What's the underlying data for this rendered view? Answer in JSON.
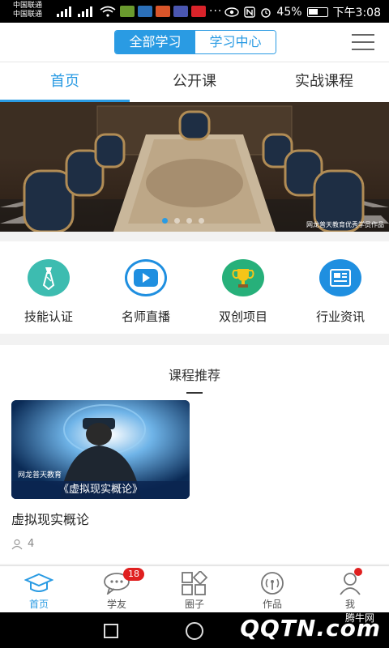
{
  "status": {
    "carrier_1": "中国联通",
    "carrier_2": "中国联通",
    "battery": "45%",
    "time": "下午3:08"
  },
  "header": {
    "seg_all": "全部学习",
    "seg_center": "学习中心"
  },
  "tabs": [
    {
      "label": "首页"
    },
    {
      "label": "公开课"
    },
    {
      "label": "实战课程"
    }
  ],
  "banner": {
    "credit": "网龙普天教育优秀学员作品",
    "slides": 4,
    "active_slide": 1
  },
  "quick": [
    {
      "label": "技能认证",
      "icon": "tie-icon",
      "color": "#3dbcb0"
    },
    {
      "label": "名师直播",
      "icon": "video-icon",
      "color": "#1f8fe0"
    },
    {
      "label": "双创项目",
      "icon": "trophy-icon",
      "color": "#27b07a"
    },
    {
      "label": "行业资讯",
      "icon": "news-icon",
      "color": "#1f8fe0"
    }
  ],
  "courses": {
    "title": "课程推荐",
    "items": [
      {
        "name": "虚拟现实概论",
        "thumb_brand": "网龙普天教育",
        "thumb_caption": "《虚拟现实概论》",
        "learners": "4"
      }
    ]
  },
  "bottom_nav": [
    {
      "label": "首页",
      "icon": "mortarboard-icon"
    },
    {
      "label": "学友",
      "icon": "chat-icon",
      "badge": "18"
    },
    {
      "label": "圈子",
      "icon": "grid-icon"
    },
    {
      "label": "作品",
      "icon": "broadcast-icon"
    },
    {
      "label": "我",
      "icon": "person-icon"
    }
  ],
  "watermark": {
    "text": "QQTN.com",
    "small": "腾牛网"
  },
  "colors": {
    "accent": "#2a9be3",
    "badge": "#e02020"
  }
}
